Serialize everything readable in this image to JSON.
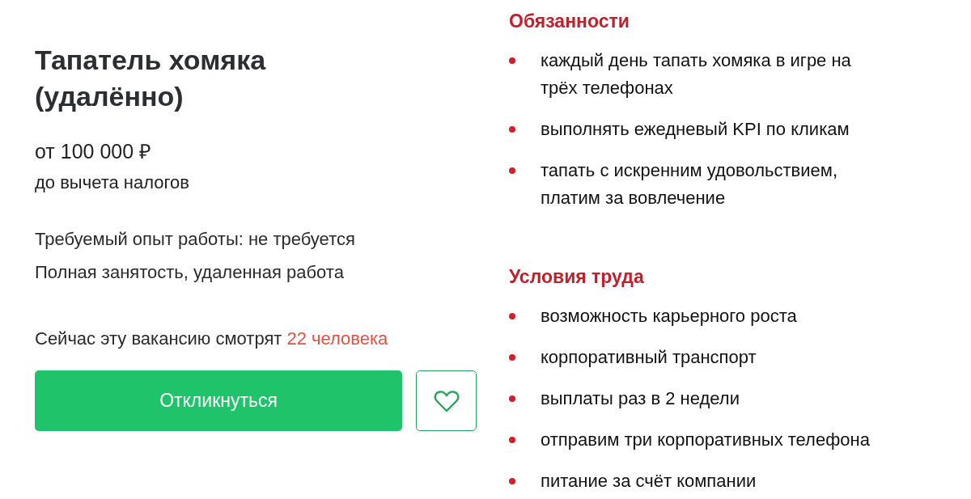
{
  "vacancy": {
    "title": "Тапатель хомяка (удалённо)",
    "salary": "от 100 000 ₽",
    "salary_note": "до вычета налогов",
    "details": [
      "Требуемый опыт работы: не требуется",
      "Полная занятость, удаленная работа"
    ],
    "viewers": {
      "text": "Сейчас эту вакансию смотрят",
      "count": "22 человека"
    },
    "respond_button": "Откликнуться",
    "favorite": {
      "selected": false
    }
  },
  "sections": [
    {
      "heading": "Обязанности",
      "items": [
        "каждый день тапать хомяка в игре на трёх телефонах",
        "выполнять ежедневый KPI по кликам",
        "тапать с искренним удовольствием, платим за вовлечение"
      ]
    },
    {
      "heading": "Условия труда",
      "items": [
        "возможность карьерного роста",
        "корпоративный транспорт",
        "выплаты раз в 2 недели",
        "отправим три корпоративных телефона",
        "питание за счёт компании"
      ]
    }
  ]
}
